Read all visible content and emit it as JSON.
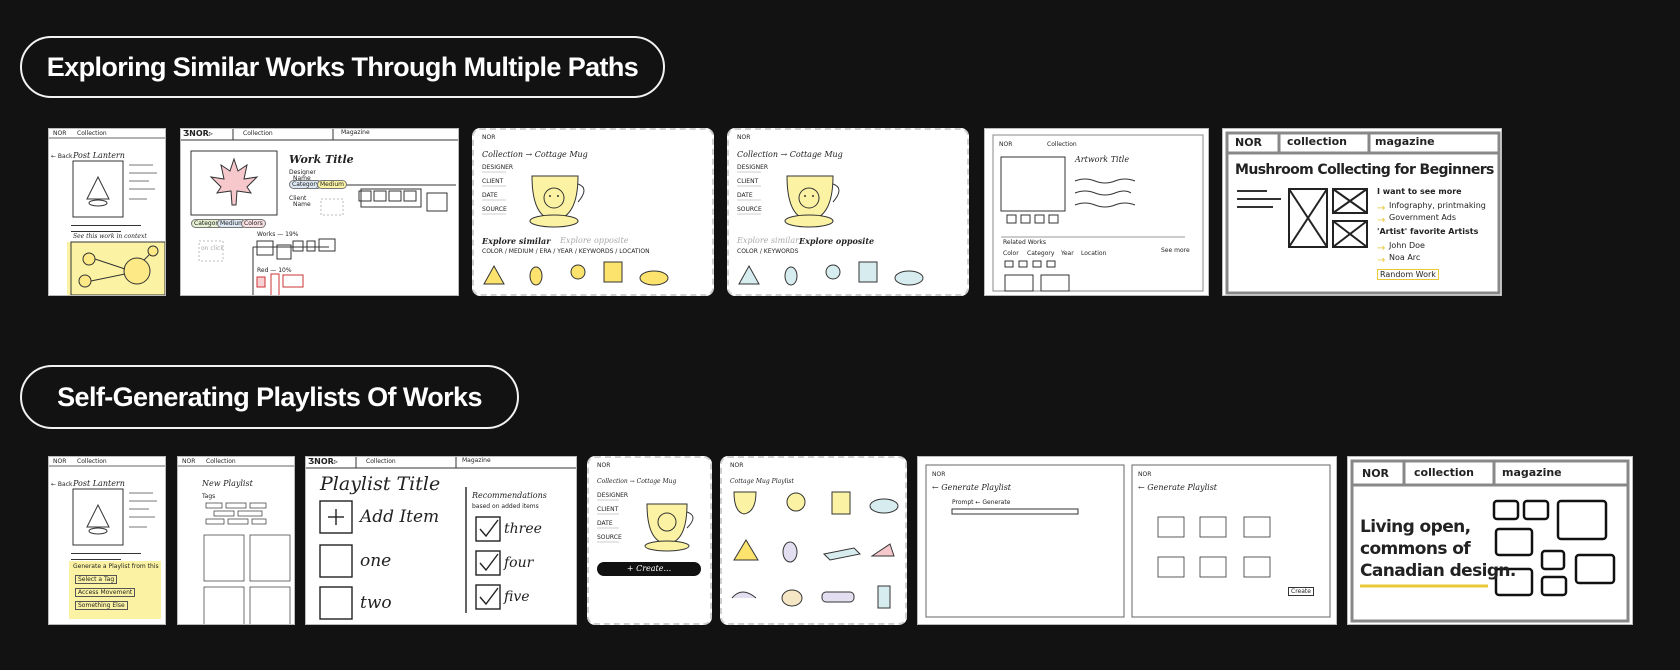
{
  "sections": [
    {
      "title": "Exploring Similar Works Through Multiple Paths"
    },
    {
      "title": "Self-Generating Playlists Of Works"
    }
  ],
  "brand": {
    "logo": "NOR",
    "logo_alt": "ƷNOR▹",
    "nav_collection": "Collection",
    "nav_collection_lc": "collection",
    "nav_magazine": "Magazine",
    "nav_magazine_lc": "magazine"
  },
  "row1": {
    "c1": {
      "back": "← Back",
      "title": "Post Lantern",
      "context": "See this work in context"
    },
    "c2": {
      "title": "Work Title",
      "designer": "Designer",
      "name": "Name",
      "client": "Client",
      "name2": "Name",
      "chips": [
        "Category",
        "Medium",
        "Colors"
      ],
      "chips2": [
        "Category",
        "Medium"
      ],
      "on_click": "on click",
      "works_label": "Works — 19%",
      "red_label": "Red — 10%"
    },
    "c3": {
      "breadcrumb": "Collection → Cottage Mug",
      "fields": [
        "DESIGNER",
        "CLIENT",
        "DATE",
        "SOURCE"
      ],
      "explore_similar": "Explore similar",
      "explore_opposite": "Explore opposite",
      "facets": "COLOR / MEDIUM / ERA / YEAR / KEYWORDS / LOCATION"
    },
    "c4": {
      "breadcrumb": "Collection → Cottage Mug",
      "fields": [
        "DESIGNER",
        "CLIENT",
        "DATE",
        "SOURCE"
      ],
      "explore_similar": "Explore similar",
      "explore_opposite": "Explore opposite",
      "facets": "COLOR / KEYWORDS"
    },
    "c5": {
      "artwork_title": "Artwork Title",
      "related": "Related Works",
      "filters": [
        "Color",
        "Category",
        "Year",
        "Location"
      ],
      "more": "See more"
    },
    "c6": {
      "heading": "Mushroom Collecting for Beginners",
      "want": "I want to see more",
      "items": [
        "Infography, printmaking",
        "Government Ads"
      ],
      "fav": "'Artist' favorite Artists",
      "artists": [
        "John Doe",
        "Noa Arc"
      ],
      "random": "Random Work"
    }
  },
  "row2": {
    "c1": {
      "back": "← Back",
      "title": "Post Lantern",
      "generate": "Generate a Playlist from this",
      "buttons": [
        "Select a Tag",
        "Access Movement",
        "Something Else"
      ]
    },
    "c2": {
      "title": "New Playlist",
      "tags": "Tags"
    },
    "c3": {
      "title": "Playlist Title",
      "add": "Add Item",
      "items": [
        "one",
        "two"
      ],
      "rec": "Recommendations",
      "rec_note": "based on added items",
      "rec_items": [
        "three",
        "four",
        "five"
      ]
    },
    "c4": {
      "breadcrumb": "Collection → Cottage Mug",
      "fields": [
        "DESIGNER",
        "CLIENT",
        "DATE",
        "SOURCE"
      ],
      "create": "+ Create..."
    },
    "c5": {
      "title": "Cottage Mug Playlist"
    },
    "c6": {
      "generate": "← Generate Playlist",
      "prompt": "Prompt ← Generate",
      "generate2": "← Generate Playlist",
      "create": "Create"
    },
    "c7": {
      "headline": [
        "Living open,",
        "commons of",
        "Canadian design."
      ]
    }
  }
}
